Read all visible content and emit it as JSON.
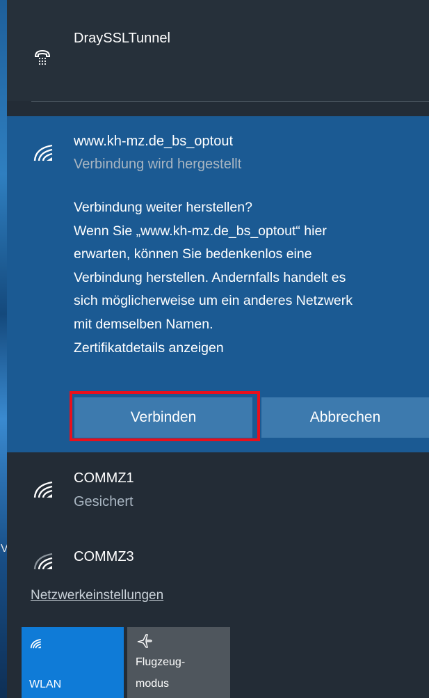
{
  "networks": {
    "vpn": {
      "name": "DraySSLTunnel",
      "icon": "vpn-phone-icon"
    },
    "active": {
      "name": "www.kh-mz.de_bs_optout",
      "status": "Verbindung wird hergestellt",
      "icon": "wifi-signal-icon",
      "message_lines": [
        "Verbindung weiter herstellen?",
        "Wenn Sie „www.kh-mz.de_bs_optout“ hier",
        "erwarten, können Sie bedenkenlos eine",
        "Verbindung herstellen. Andernfalls handelt es",
        "sich möglicherweise um ein anderes Netzwerk",
        "mit demselben Namen.",
        "Zertifikatdetails anzeigen"
      ],
      "connect_label": "Verbinden",
      "cancel_label": "Abbrechen"
    },
    "list": [
      {
        "name": "COMMZ1",
        "status": "Gesichert",
        "icon": "wifi-signal-icon"
      },
      {
        "name": "COMMZ3",
        "status": "",
        "icon": "wifi-signal-weak-icon"
      }
    ]
  },
  "settings_link": "Netzwerkeinstellungen",
  "desktop_fragment": "V",
  "quick_actions": [
    {
      "label": "WLAN",
      "icon": "wifi-icon",
      "active": true
    },
    {
      "label_line1": "Flugzeug-",
      "label_line2": "modus",
      "icon": "airplane-icon",
      "active": false
    }
  ],
  "colors": {
    "panel_bg": "#232c36",
    "expanded_bg": "#1b5a93",
    "button_bg": "#3d7aae",
    "highlight": "#e8101c",
    "wlan_tile": "#0f7bd7",
    "airplane_tile": "#4f565d"
  }
}
